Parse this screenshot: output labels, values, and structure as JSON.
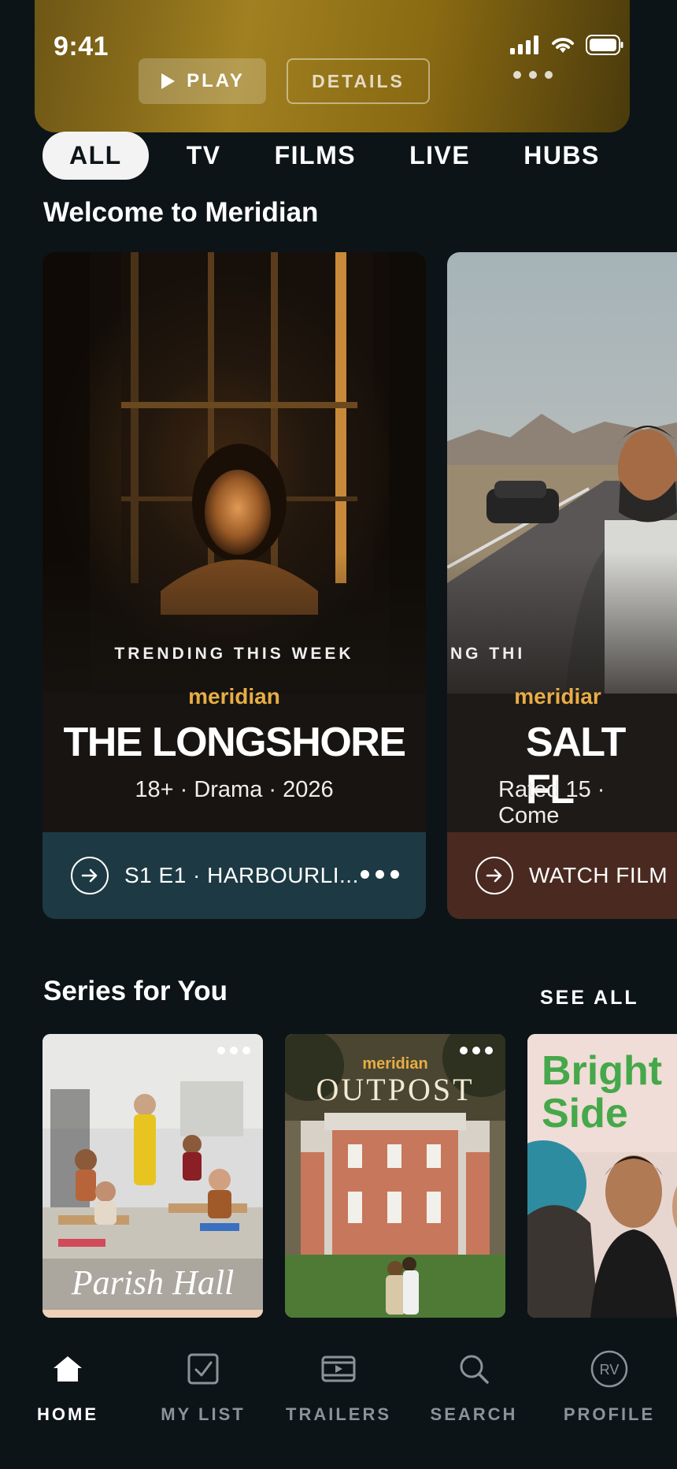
{
  "status_bar": {
    "time": "9:41"
  },
  "hero": {
    "play_label": "PLAY",
    "details_label": "DETAILS"
  },
  "tabs": [
    {
      "label": "ALL",
      "active": true
    },
    {
      "label": "TV"
    },
    {
      "label": "FILMS"
    },
    {
      "label": "LIVE"
    },
    {
      "label": "HUBS"
    }
  ],
  "welcome": {
    "title": "Welcome to Meridian"
  },
  "featured": [
    {
      "kicker": "TRENDING THIS WEEK",
      "brand": "meridian",
      "title": "THE LONGSHORE",
      "meta": "18+ · Drama · 2026",
      "cta": "S1 E1 · HARBOURLI...",
      "cta_color": "#1d3a44"
    },
    {
      "kicker": "TRENDING THI",
      "brand": "meridiar",
      "title": "SALT FL",
      "meta": "Rated 15 · Come",
      "cta": "WATCH FILM",
      "cta_color": "#4a2a20"
    }
  ],
  "series_section": {
    "title": "Series for You",
    "see_all": "SEE ALL"
  },
  "series": [
    {
      "logo": "Parish Hall"
    },
    {
      "brand": "meridian",
      "logo": "OUTPOST"
    },
    {
      "logo_line1": "Bright",
      "logo_line2": "Side"
    }
  ],
  "bottom_nav": [
    {
      "label": "HOME",
      "icon": "home-icon",
      "active": true
    },
    {
      "label": "MY LIST",
      "icon": "checkbox-icon"
    },
    {
      "label": "TRAILERS",
      "icon": "trailer-icon"
    },
    {
      "label": "SEARCH",
      "icon": "search-icon"
    },
    {
      "label": "PROFILE",
      "icon": "profile-avatar",
      "initials": "RV"
    }
  ],
  "colors": {
    "background": "#0c1418",
    "accent": "#e7ad45",
    "hero_gold": "#a08020",
    "bright_side_green": "#45a84a"
  }
}
